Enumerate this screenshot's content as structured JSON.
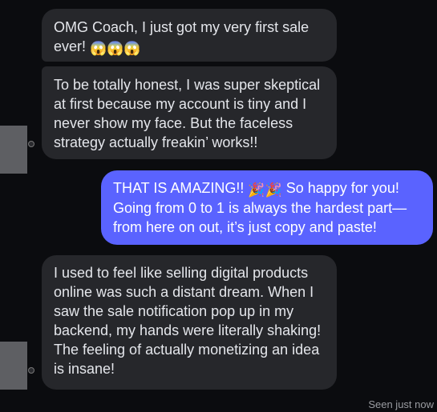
{
  "messages": [
    {
      "direction": "incoming",
      "text": "OMG Coach, I just got my very first sale ever!",
      "emoji": "😱😱😱"
    },
    {
      "direction": "incoming",
      "text": "To be totally honest, I was super skeptical at first because my account is tiny and I never show my face. But the faceless strategy actually freakin’ works!!"
    },
    {
      "direction": "outgoing",
      "text_before": "THAT IS AMAZING!!",
      "emoji": "🎉🎉",
      "text_after": "So happy for you! Going from 0 to 1 is always the hardest part—from here on out, it’s just copy and paste!"
    },
    {
      "direction": "incoming",
      "text": "I used to feel like selling digital products online was such a distant dream. When I saw the sale notification pop up in my backend, my hands were literally shaking! The feeling of actually monetizing an idea is insane!"
    }
  ],
  "status": {
    "seen": "Seen just now"
  },
  "colors": {
    "background": "#0b0c0f",
    "incoming_bubble": "#26272b",
    "outgoing_bubble": "#5a63ff",
    "text": "#e4e6eb"
  },
  "icons": {
    "avatar": "avatar-icon"
  }
}
